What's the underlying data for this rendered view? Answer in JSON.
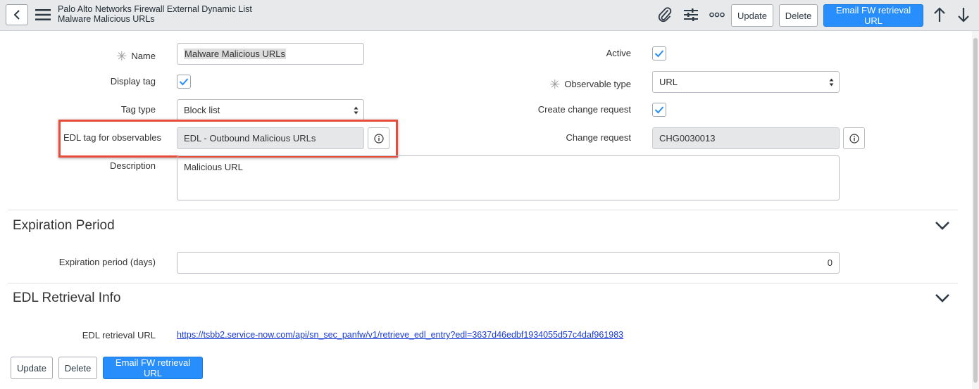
{
  "header": {
    "table_title": "Palo Alto Networks Firewall External Dynamic List",
    "record_title": "Malware Malicious URLs",
    "buttons": {
      "update": "Update",
      "delete": "Delete",
      "email": "Email FW retrieval URL"
    },
    "icons": [
      "back-icon",
      "menu-icon",
      "attachment-icon",
      "settings-sliders-icon",
      "more-icon",
      "arrow-up-icon",
      "arrow-down-icon"
    ]
  },
  "form": {
    "name_label": "Name",
    "name_value": "Malware Malicious URLs",
    "display_tag_label": "Display tag",
    "display_tag_checked": true,
    "tag_type_label": "Tag type",
    "tag_type_value": "Block list",
    "edl_tag_label": "EDL tag for observables",
    "edl_tag_value": "EDL - Outbound Malicious URLs",
    "description_label": "Description",
    "description_value": "Malicious URL",
    "active_label": "Active",
    "active_checked": true,
    "observable_type_label": "Observable type",
    "observable_type_value": "URL",
    "create_change_label": "Create change request",
    "create_change_checked": true,
    "change_request_label": "Change request",
    "change_request_value": "CHG0030013"
  },
  "expiration": {
    "title": "Expiration Period",
    "period_label": "Expiration period (days)",
    "period_value": "0"
  },
  "edl_info": {
    "title": "EDL Retrieval Info",
    "url_label": "EDL retrieval URL",
    "url_value": "https://tsbb2.service-now.com/api/sn_sec_panfw/v1/retrieve_edl_entry?edl=3637d46edbf1934055d57c4daf961983"
  },
  "footer": {
    "update": "Update",
    "delete": "Delete",
    "email": "Email FW retrieval URL"
  },
  "colors": {
    "primary_button": "#278efc",
    "highlight_border": "#e84a3b",
    "link": "#1a3ad6",
    "checkmark": "#278efc"
  }
}
